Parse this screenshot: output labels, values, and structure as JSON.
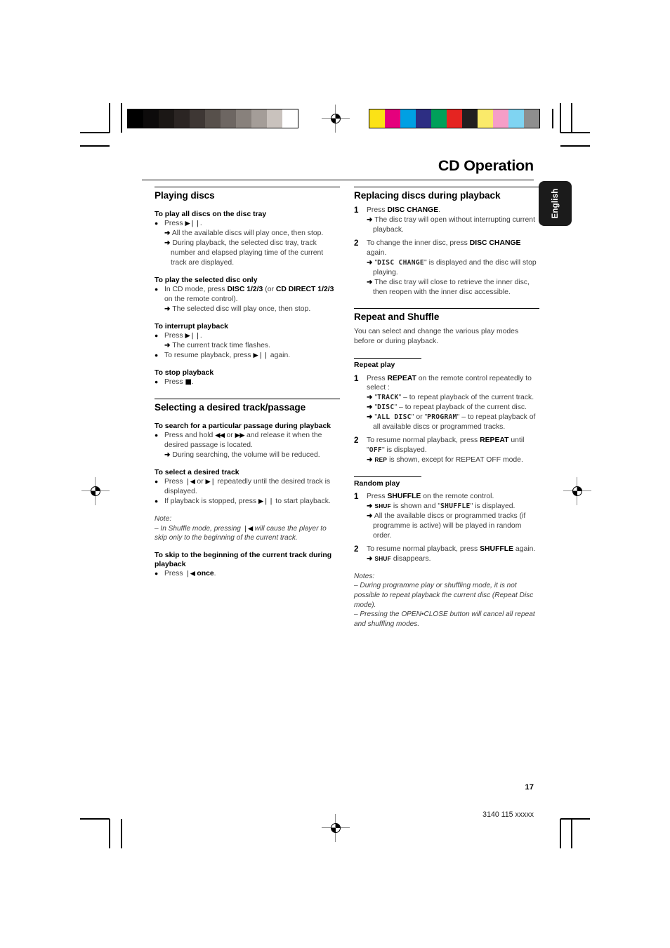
{
  "document": {
    "title": "CD Operation",
    "language_tab": "English",
    "page_number": "17",
    "footer_code": "3140 115 xxxxx"
  },
  "prepress": {
    "grayscale_swatches": [
      "#000000",
      "#0d0b0b",
      "#1b1715",
      "#2b2523",
      "#3e3734",
      "#57504b",
      "#6d6662",
      "#88817c",
      "#a49d98",
      "#c9c2bd",
      "#ffffff"
    ],
    "color_swatches": [
      "#fbe216",
      "#e5007d",
      "#00a0e3",
      "#2d2e83",
      "#00a05a",
      "#e52421",
      "#231f20",
      "#faea6a",
      "#f59ec7",
      "#7fd4f2",
      "#8e8e8e"
    ]
  },
  "left_column": {
    "section1": {
      "heading": "Playing discs",
      "blocks": [
        {
          "sub": "To play all discs on the disc tray",
          "lines": [
            {
              "kind": "bullet",
              "pre": "Press ",
              "glyph": "▶❘❘",
              "post": "."
            },
            {
              "kind": "arrow",
              "text": "All the available discs will play once, then stop."
            },
            {
              "kind": "arrow",
              "text": "During playback, the selected disc tray, track number and elapsed playing time of the current track are displayed."
            }
          ]
        },
        {
          "sub": "To play the selected disc only",
          "lines": [
            {
              "kind": "bullet",
              "text_a": "In CD mode, press ",
              "bold_a": "DISC 1/2/3",
              "text_b": " (or ",
              "bold_b": "CD DIRECT 1/2/3",
              "text_c": " on the remote control)."
            },
            {
              "kind": "arrow",
              "text": "The selected disc will play once, then stop."
            }
          ]
        },
        {
          "sub": "To interrupt playback",
          "lines": [
            {
              "kind": "bullet",
              "pre": "Press ",
              "glyph": "▶❘❘",
              "post": "."
            },
            {
              "kind": "arrow",
              "text": "The current track time flashes."
            },
            {
              "kind": "bullet",
              "pre": "To resume playback, press ",
              "glyph": "▶❘❘",
              "post": " again."
            }
          ]
        },
        {
          "sub": "To stop playback",
          "lines": [
            {
              "kind": "bullet",
              "pre": "Press ",
              "glyph": "■",
              "post": "."
            }
          ]
        }
      ]
    },
    "section2": {
      "heading": "Selecting a desired track/passage",
      "blocks": [
        {
          "sub": "To search for a particular passage during playback",
          "lines": [
            {
              "kind": "bullet",
              "pre": "Press and hold ",
              "glyph_a": "◀◀",
              "mid": " or ",
              "glyph_b": "▶▶",
              "post": " and release it when the desired passage is located."
            },
            {
              "kind": "arrow",
              "text": "During searching, the volume will be reduced."
            }
          ]
        },
        {
          "sub": "To select a desired track",
          "lines": [
            {
              "kind": "bullet",
              "pre": "Press ",
              "glyph_a": "❘◀",
              "mid": " or ",
              "glyph_b": "▶❘",
              "post": " repeatedly until the desired track is displayed."
            },
            {
              "kind": "bullet",
              "pre": "If playback is stopped, press ",
              "glyph": "▶❘❘",
              "post": " to start playback."
            }
          ]
        },
        {
          "note_label": "Note:",
          "note_lines": [
            {
              "pre": "–  In Shuffle mode, pressing ",
              "glyph": "❘◀",
              "post": " will cause the player to skip only to the beginning of the current track."
            }
          ]
        },
        {
          "sub": "To skip to the beginning of the current track during playback",
          "lines": [
            {
              "kind": "bullet",
              "pre": "Press ",
              "glyph": "❘◀",
              "bold_post": " once",
              "post": "."
            }
          ]
        }
      ]
    }
  },
  "right_column": {
    "section1": {
      "heading": "Replacing discs during playback",
      "steps": [
        {
          "num": "1",
          "lines": [
            {
              "kind": "text",
              "text_a": "Press ",
              "bold_a": "DISC CHANGE",
              "text_b": "."
            },
            {
              "kind": "arrow",
              "text": "The disc tray will open without interrupting current playback."
            }
          ]
        },
        {
          "num": "2",
          "lines": [
            {
              "kind": "text",
              "text_a": "To change the inner disc, press ",
              "bold_a": "DISC CHANGE",
              "text_b": " again."
            },
            {
              "kind": "arrow_lcd",
              "quote_open": "\"",
              "lcd": "DISC CHANGE",
              "quote_close": "\"",
              "text": " is displayed and the disc will stop playing."
            },
            {
              "kind": "arrow",
              "text": "The disc tray will close to retrieve the inner disc, then reopen with the inner disc accessible."
            }
          ]
        }
      ]
    },
    "section2": {
      "heading": "Repeat and Shuffle",
      "intro": "You can select and change the various play modes before or during playback.",
      "repeat": {
        "sub": "Repeat play",
        "steps": [
          {
            "num": "1",
            "lines": [
              {
                "kind": "text",
                "text_a": "Press ",
                "bold_a": "REPEAT",
                "text_b": " on the remote control repeatedly to select :"
              },
              {
                "kind": "arrow_lcd",
                "quote_open": "\"",
                "lcd": "TRACK",
                "quote_close": "\"",
                "text": " – to repeat playback of the current track."
              },
              {
                "kind": "arrow_lcd",
                "quote_open": "\"",
                "lcd": "DISC",
                "quote_close": "\"",
                "text": " – to repeat playback of the current disc."
              },
              {
                "kind": "arrow_lcd2",
                "lcd_a": "ALL DISC",
                "mid": " or ",
                "lcd_b": "PROGRAM",
                "text": " – to repeat playback of all available discs or programmed tracks."
              }
            ]
          },
          {
            "num": "2",
            "lines": [
              {
                "kind": "text_lcd",
                "text_a": "To resume normal playback, press ",
                "bold_a": "REPEAT",
                "text_b": " until ",
                "lcd": "OFF",
                "text_c": " is displayed."
              },
              {
                "kind": "arrow_caps",
                "caps": "REP",
                "text": " is shown, except for REPEAT OFF mode."
              }
            ]
          }
        ]
      },
      "random": {
        "sub": "Random play",
        "steps": [
          {
            "num": "1",
            "lines": [
              {
                "kind": "text",
                "text_a": "Press ",
                "bold_a": "SHUFFLE",
                "text_b": " on the remote control."
              },
              {
                "kind": "arrow_caps_lcd",
                "caps": "SHUF",
                "text_a": " is shown and ",
                "lcd": "SHUFFLE",
                "text_b": " is displayed."
              },
              {
                "kind": "arrow",
                "text": "All the available discs or programmed tracks (if programme is active) will be played in random order."
              }
            ]
          },
          {
            "num": "2",
            "lines": [
              {
                "kind": "text",
                "text_a": "To resume normal playback, press ",
                "bold_a": "SHUFFLE",
                "text_b": " again."
              },
              {
                "kind": "arrow_caps",
                "caps": "SHUF",
                "text": " disappears."
              }
            ]
          }
        ]
      },
      "notes": {
        "label": "Notes:",
        "items": [
          "–  During programme play or shuffling mode, it is not possible to repeat playback the current disc (Repeat Disc mode).",
          "–  Pressing the OPEN•CLOSE button will cancel all repeat and shuffling modes."
        ]
      }
    }
  }
}
